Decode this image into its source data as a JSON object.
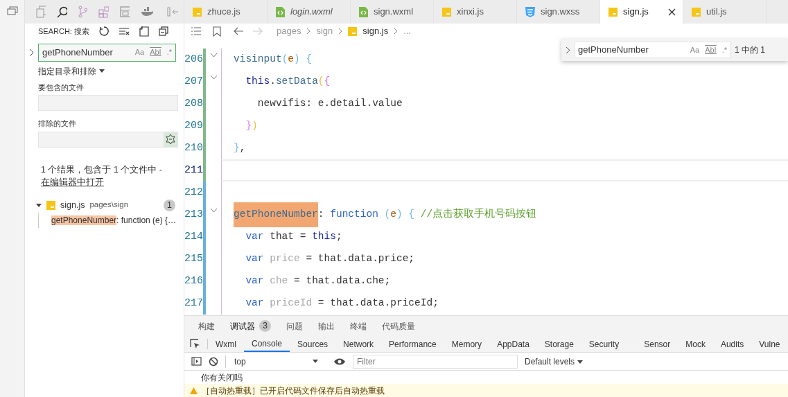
{
  "sidebar": {
    "title": "SEARCH: 搜索",
    "search": {
      "value": "getPhoneNumber",
      "options": [
        "Aa",
        "AbI",
        ".*"
      ]
    },
    "scope_toggle": "指定目录和排除",
    "include": {
      "label": "要包含的文件"
    },
    "exclude": {
      "label": "排除的文件"
    },
    "summary": "1 个结果，包含于 1 个文件中 -",
    "open_link": "在编辑器中打开",
    "results": [
      {
        "file": "sign.js",
        "path": "pages\\sign",
        "count": "1",
        "expanded": true,
        "children": [
          {
            "match": "getPhoneNumber",
            "rest": ": function (e) {…"
          }
        ]
      }
    ]
  },
  "editor": {
    "tabs": [
      {
        "label": "zhuce.js",
        "kind": "js",
        "preview": false,
        "selected": false
      },
      {
        "label": "login.wxml",
        "kind": "wxml",
        "preview": true,
        "selected": false
      },
      {
        "label": "sign.wxml",
        "kind": "wxml",
        "preview": false,
        "selected": false
      },
      {
        "label": "xinxi.js",
        "kind": "js",
        "preview": false,
        "selected": false
      },
      {
        "label": "sign.wxss",
        "kind": "wxss",
        "preview": false,
        "selected": false
      },
      {
        "label": "sign.js",
        "kind": "js",
        "preview": false,
        "selected": true
      },
      {
        "label": "util.js",
        "kind": "js",
        "preview": false,
        "selected": false
      }
    ],
    "breadcrumbs": [
      {
        "label": "pages",
        "kind": "folder"
      },
      {
        "label": "sign",
        "kind": "folder"
      },
      {
        "label": "sign.js",
        "kind": "file"
      },
      {
        "label": "...",
        "kind": "more"
      }
    ],
    "find_widget": {
      "value": "getPhoneNumber",
      "options": [
        "Aa",
        "AbI",
        ".*"
      ],
      "result": "1 中的 1"
    },
    "lines": [
      {
        "number": "206",
        "color": "#81b88b",
        "foldable": true,
        "current": false,
        "tokens": [
          {
            "kind": "fn",
            "t": "visinput"
          },
          {
            "kind": "b1",
            "t": "("
          },
          {
            "kind": "param",
            "t": "e"
          },
          {
            "kind": "b1",
            "t": ") {"
          }
        ]
      },
      {
        "number": "207",
        "color": "#81b88b",
        "foldable": true,
        "current": false,
        "tokens": [
          {
            "kind": "kw2",
            "t": "  this"
          },
          {
            "kind": "plain",
            "t": "."
          },
          {
            "kind": "fn",
            "t": "setData"
          },
          {
            "kind": "b3",
            "t": "("
          },
          {
            "kind": "b2",
            "t": "{"
          }
        ]
      },
      {
        "number": "208",
        "color": "#81b88b",
        "foldable": false,
        "current": false,
        "tokens": [
          {
            "kind": "plain",
            "t": "    newvifis: e.detail.value"
          }
        ]
      },
      {
        "number": "209",
        "color": "#81b88b",
        "foldable": false,
        "current": false,
        "tokens": [
          {
            "kind": "b2",
            "t": "  }"
          },
          {
            "kind": "b3",
            "t": ")"
          }
        ]
      },
      {
        "number": "210",
        "color": "#81b88b",
        "foldable": false,
        "current": false,
        "tokens": [
          {
            "kind": "b1",
            "t": "}"
          },
          {
            "kind": "plain",
            "t": ","
          }
        ]
      },
      {
        "number": "211",
        "color": "#81b88b",
        "foldable": false,
        "current": true
      },
      {
        "number": "212",
        "color": "#66afe0",
        "foldable": false,
        "current": false
      },
      {
        "number": "213",
        "color": "#66afe0",
        "foldable": true,
        "current": false,
        "tokens": [
          {
            "kind": "match",
            "t": "getPhoneNumber"
          },
          {
            "kind": "plain",
            "t": ": "
          },
          {
            "kind": "kw",
            "t": "function "
          },
          {
            "kind": "b1",
            "t": "("
          },
          {
            "kind": "param",
            "t": "e"
          },
          {
            "kind": "b1",
            "t": ") { "
          },
          {
            "kind": "comment",
            "t": "//点击获取手机号码按钮"
          }
        ]
      },
      {
        "number": "214",
        "color": "#66afe0",
        "foldable": false,
        "current": false,
        "tokens": [
          {
            "kind": "kw",
            "t": "  var"
          },
          {
            "kind": "plain",
            "t": " that = "
          },
          {
            "kind": "kw2",
            "t": "this"
          },
          {
            "kind": "plain",
            "t": ";"
          }
        ]
      },
      {
        "number": "215",
        "color": "#66afe0",
        "foldable": false,
        "current": false,
        "tokens": [
          {
            "kind": "kw",
            "t": "  var "
          },
          {
            "kind": "faded",
            "t": "price"
          },
          {
            "kind": "plain",
            "t": " = that.data.price;"
          }
        ]
      },
      {
        "number": "216",
        "color": "#66afe0",
        "foldable": false,
        "current": false,
        "tokens": [
          {
            "kind": "kw",
            "t": "  var "
          },
          {
            "kind": "faded",
            "t": "che"
          },
          {
            "kind": "plain",
            "t": " = that.data.che;"
          }
        ]
      },
      {
        "number": "217",
        "color": "#66afe0",
        "foldable": false,
        "current": false,
        "tokens": [
          {
            "kind": "kw",
            "t": "  var "
          },
          {
            "kind": "faded",
            "t": "priceId"
          },
          {
            "kind": "plain",
            "t": " = that.data.priceId;"
          }
        ]
      }
    ]
  },
  "panel": {
    "tabs": [
      {
        "label": "构建",
        "selected": false
      },
      {
        "label": "调试器",
        "selected": true,
        "badge": "3"
      },
      {
        "label": "问题",
        "selected": false
      },
      {
        "label": "输出",
        "selected": false
      },
      {
        "label": "终端",
        "selected": false
      },
      {
        "label": "代码质量",
        "selected": false
      }
    ],
    "devtools_tabs": [
      {
        "label": "Wxml",
        "selected": false
      },
      {
        "label": "Console",
        "selected": true
      },
      {
        "label": "Sources",
        "selected": false
      },
      {
        "label": "Network",
        "selected": false
      },
      {
        "label": "Performance",
        "selected": false
      },
      {
        "label": "Memory",
        "selected": false
      },
      {
        "label": "AppData",
        "selected": false
      },
      {
        "label": "Storage",
        "selected": false
      },
      {
        "label": "Security",
        "selected": false
      },
      {
        "label": "Sensor",
        "selected": false
      },
      {
        "label": "Mock",
        "selected": false
      },
      {
        "label": "Audits",
        "selected": false
      },
      {
        "label": "Vulne",
        "selected": false
      }
    ],
    "context": "top",
    "filter_placeholder": "Filter",
    "levels": "Default levels",
    "messages": [
      {
        "kind": "log",
        "text": "你有关闭吗"
      },
      {
        "kind": "warning",
        "text": "［自动热重载］已开启代码文件保存后自动热重载"
      }
    ]
  }
}
